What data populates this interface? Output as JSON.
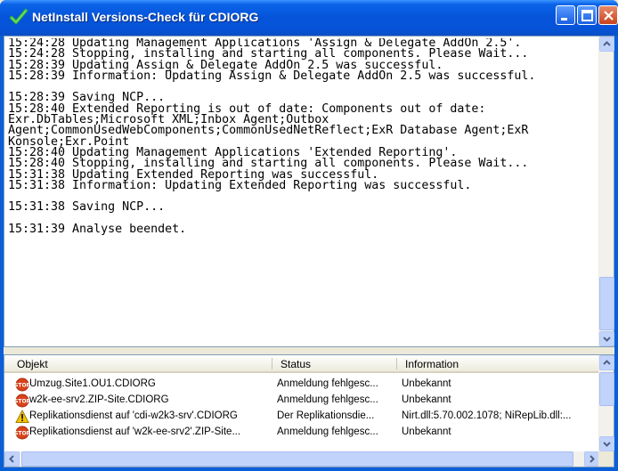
{
  "window": {
    "title": "NetInstall Versions-Check für CDIORG"
  },
  "log": {
    "text": "15:24:28 Updating Management Applications 'Assign & Delegate AddOn 2.5'.\n15:24:28 Stopping, installing and starting all components. Please Wait...\n15:28:39 Updating Assign & Delegate AddOn 2.5 was successful.\n15:28:39 Information: Updating Assign & Delegate AddOn 2.5 was successful.\n\n15:28:39 Saving NCP...\n15:28:40 Extended Reporting is out of date: Components out of date: Exr.DbTables;Microsoft XML;Inbox Agent;Outbox Agent;CommonUsedWebComponents;CommonUsedNetReflect;ExR Database Agent;ExR Konsole;Exr.Point\n15:28:40 Updating Management Applications 'Extended Reporting'.\n15:28:40 Stopping, installing and starting all components. Please Wait...\n15:31:38 Updating Extended Reporting was successful.\n15:31:38 Information: Updating Extended Reporting was successful.\n\n15:31:38 Saving NCP...\n\n15:31:39 Analyse beendet."
  },
  "list": {
    "columns": {
      "objekt": "Objekt",
      "status": "Status",
      "information": "Information"
    },
    "rows": [
      {
        "icon": "stop-icon",
        "objekt": "Umzug.Site1.OU1.CDIORG",
        "status": "Anmeldung fehlgesc...",
        "information": "Unbekannt"
      },
      {
        "icon": "stop-icon",
        "objekt": "w2k-ee-srv2.ZIP-Site.CDIORG",
        "status": "Anmeldung fehlgesc...",
        "information": "Unbekannt"
      },
      {
        "icon": "warning-icon",
        "objekt": "Replikationsdienst auf 'cdi-w2k3-srv'.CDIORG",
        "status": "Der Replikationsdie...",
        "information": "Nirt.dll:5.70.002.1078; NiRepLib.dll:..."
      },
      {
        "icon": "stop-icon",
        "objekt": "Replikationsdienst auf 'w2k-ee-srv2'.ZIP-Site...",
        "status": "Anmeldung fehlgesc...",
        "information": "Unbekannt"
      }
    ]
  },
  "colors": {
    "titlebar": "#0553d8",
    "stop": "#d9421b",
    "warning": "#f6c500",
    "scrollbar": "#c1d3fb"
  }
}
